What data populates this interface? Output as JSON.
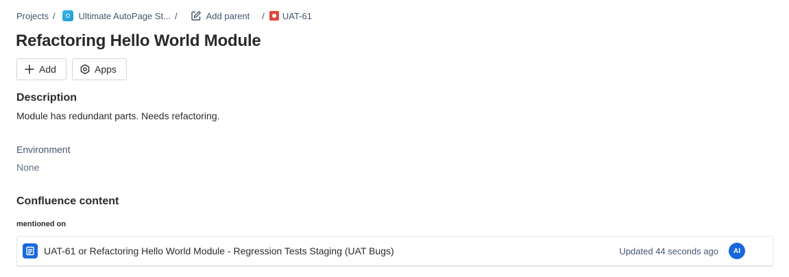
{
  "breadcrumb": {
    "projects": "Projects",
    "separator": "/",
    "project_name": "Ultimate AutoPage St...",
    "add_parent": "Add parent",
    "issue_key": "UAT-61"
  },
  "issue": {
    "title": "Refactoring Hello World Module"
  },
  "toolbar": {
    "add_label": "Add",
    "apps_label": "Apps"
  },
  "description": {
    "heading": "Description",
    "text": "Module has redundant parts. Needs refactoring."
  },
  "environment": {
    "label": "Environment",
    "value": "None"
  },
  "confluence": {
    "heading": "Confluence content",
    "mentioned_label": "mentioned on",
    "page": {
      "title": "UAT-61 or Refactoring Hello World Module - Regression Tests Staging (UAT Bugs)",
      "updated": "Updated 44 seconds ago",
      "avatar_initials": "AI"
    }
  },
  "icons": {
    "project": "project-icon",
    "add_parent": "edit-icon",
    "issue_type": "bug-icon",
    "add": "plus-icon",
    "apps": "apps-hexagon-icon",
    "confluence_page": "page-icon"
  },
  "colors": {
    "accent": "#1868db",
    "bug": "#e2483d",
    "project": "#1e9ad6"
  }
}
